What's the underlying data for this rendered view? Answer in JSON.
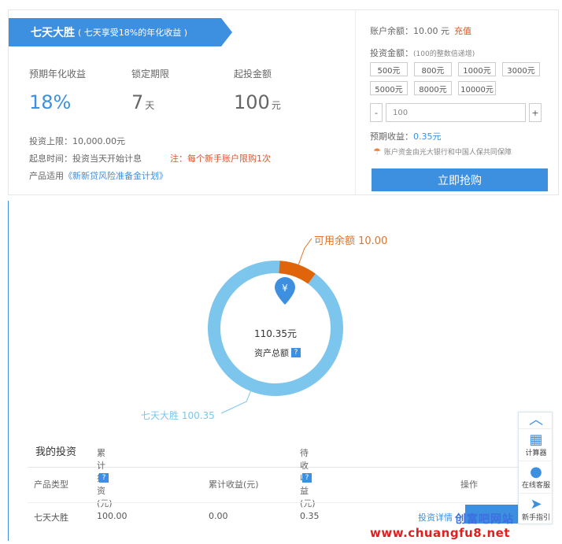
{
  "product": {
    "name": "七天大胜",
    "subtitle": "( 七天享受18%的年化收益 )",
    "annual_rate_label": "预期年化收益",
    "annual_rate": "18%",
    "lock_label": "锁定期限",
    "lock_value": "7",
    "lock_unit": "天",
    "min_label": "起投金额",
    "min_value": "100",
    "min_unit": "元",
    "cap": "投资上限：10,000.00元",
    "start_time": "起息时间：投资当天开始计息",
    "limit_note": "注：每个新手账户限购1次",
    "applies_prefix": "产品适用",
    "applies_link": "《新新贷风险准备金计划》"
  },
  "purchase": {
    "balance_label": "账户余额：",
    "balance_value": "10.00 元",
    "recharge": "充值",
    "amount_label": "投资金额：",
    "amount_hint": "(100的整数倍递增)",
    "amounts": [
      "500元",
      "800元",
      "1000元",
      "3000元",
      "5000元",
      "8000元",
      "10000元"
    ],
    "minus": "-",
    "input_value": "100",
    "plus": "+",
    "expected_label": "预期收益：",
    "expected_value": "0.35元",
    "guarantee": "账户资金由光大银行和中国人保共同保障",
    "buy_button": "立即抢购"
  },
  "chart_data": {
    "type": "pie",
    "title": "",
    "center_value": "110.35元",
    "center_label": "资产总额",
    "slices": [
      {
        "name": "七天大胜",
        "label": "七天大胜 100.35",
        "value": 100.35,
        "color": "#7cc6ee"
      },
      {
        "name": "可用余额",
        "label": "可用余额 10.00",
        "value": 10.0,
        "color": "#e0640a"
      }
    ],
    "currency_icon": "¥"
  },
  "my_investment": {
    "title": "我的投资",
    "columns": [
      "产品类型",
      "累计投资(元)",
      "累计收益(元)",
      "待收收益(元)",
      "操作"
    ],
    "row": [
      "七天大胜",
      "100.00",
      "0.00",
      "0.35",
      "投资详情"
    ]
  },
  "float_bar": {
    "calculator": "计算器",
    "service": "在线客服",
    "guide": "新手指引"
  },
  "watermark": {
    "cn": "创富吧网站",
    "url": "www.chuangfu8.net"
  },
  "colors": {
    "accent": "#3d8fe0",
    "warn": "#e0542a"
  }
}
